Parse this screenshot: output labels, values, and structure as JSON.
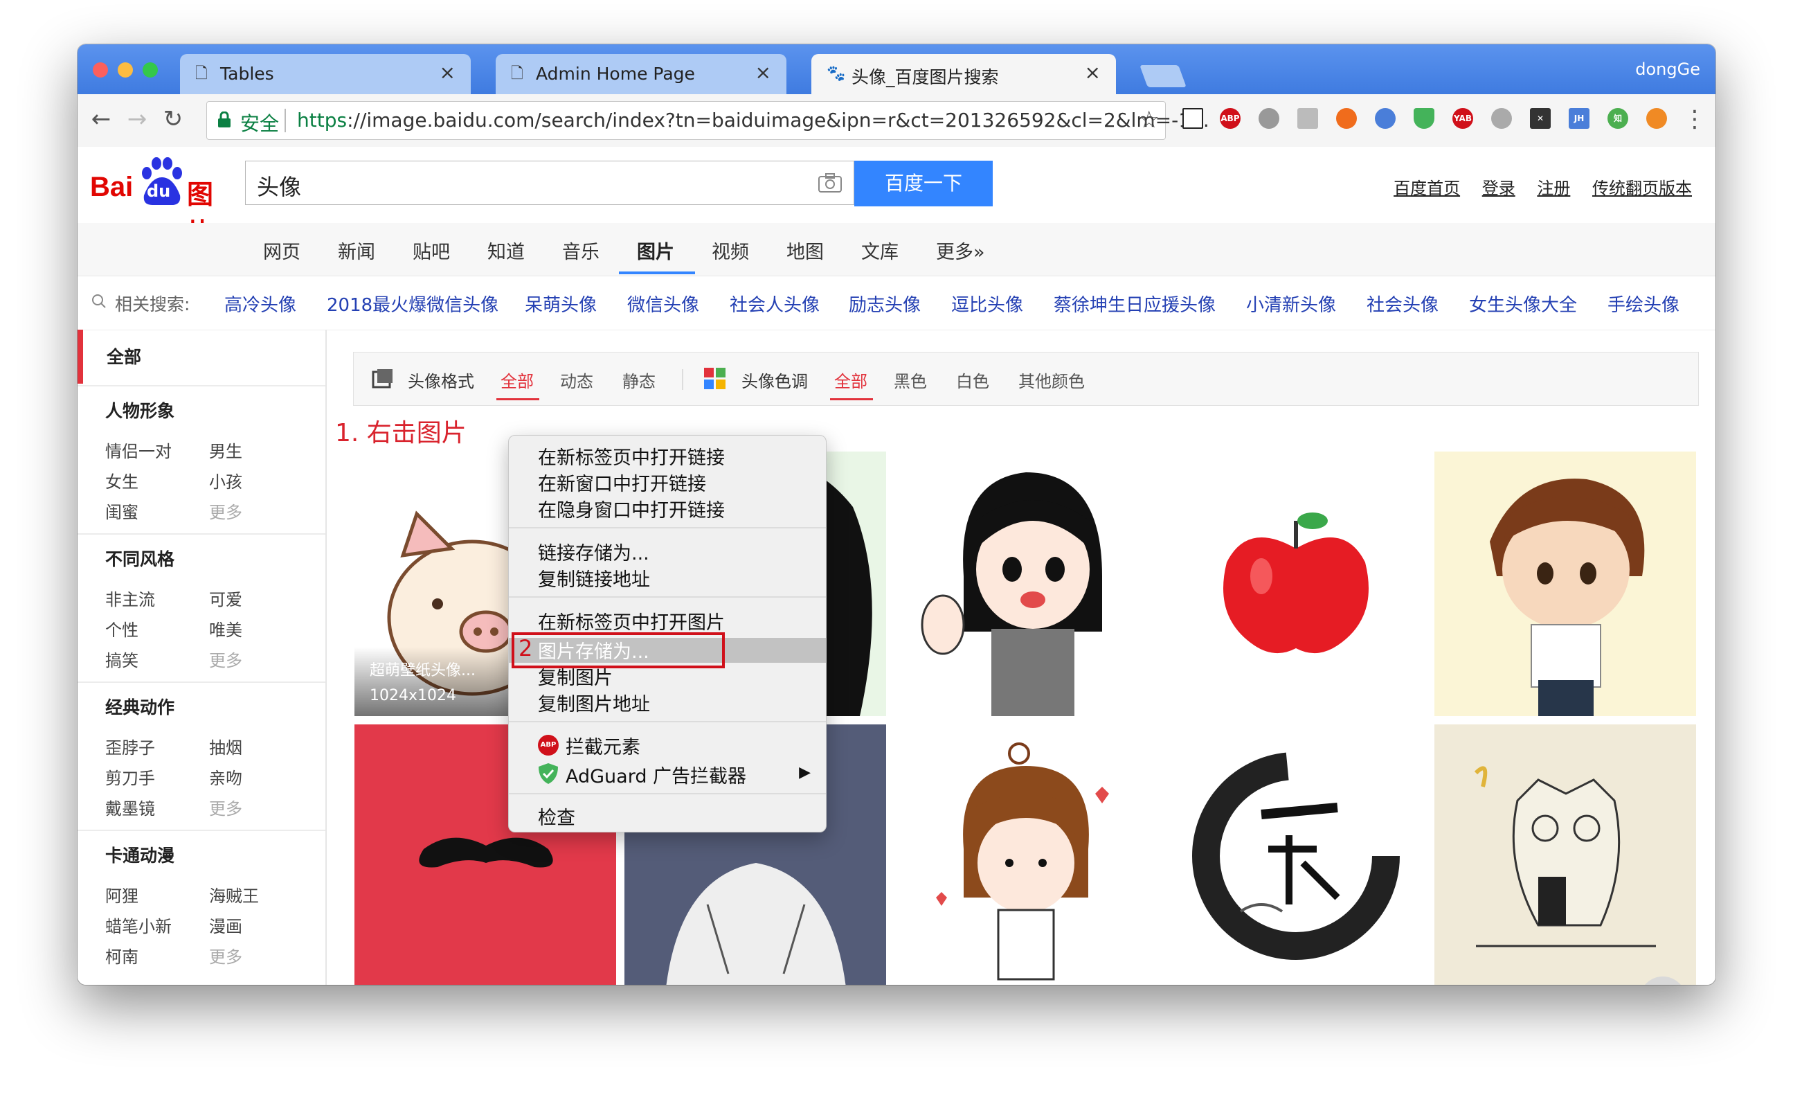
{
  "window": {
    "profile": "dongGe"
  },
  "tabs": [
    {
      "title": "Tables"
    },
    {
      "title": "Admin Home Page"
    },
    {
      "title": "头像_百度图片搜索"
    }
  ],
  "toolbar": {
    "secure_label": "安全",
    "url_scheme": "https",
    "url_rest": "://image.baidu.com/search/index?tn=baiduimage&ipn=r&ct=201326592&cl=2&lm=-1..."
  },
  "extensions": [
    "ABP",
    "YAB",
    "JH",
    "知"
  ],
  "header": {
    "logo_text_bai": "Bai",
    "logo_text_du": "du",
    "logo_text_tupian": "图片",
    "query": "头像",
    "search_button": "百度一下",
    "links": [
      "百度首页",
      "登录",
      "注册",
      "传统翻页版本"
    ]
  },
  "nav": {
    "items": [
      "网页",
      "新闻",
      "贴吧",
      "知道",
      "音乐",
      "图片",
      "视频",
      "地图",
      "文库",
      "更多»"
    ],
    "active": "图片"
  },
  "related": {
    "label": "相关搜索:",
    "links": [
      "高冷头像",
      "2018最火爆微信头像",
      "呆萌头像",
      "微信头像",
      "社会人头像",
      "励志头像",
      "逗比头像",
      "蔡徐坤生日应援头像",
      "小清新头像",
      "社会头像",
      "女生头像大全",
      "手绘头像"
    ]
  },
  "sidebar": {
    "all": "全部",
    "groups": [
      {
        "title": "人物形象",
        "items": [
          "情侣一对",
          "男生",
          "女生",
          "小孩",
          "闺蜜",
          "更多"
        ]
      },
      {
        "title": "不同风格",
        "items": [
          "非主流",
          "可爱",
          "个性",
          "唯美",
          "搞笑",
          "更多"
        ]
      },
      {
        "title": "经典动作",
        "items": [
          "歪脖子",
          "抽烟",
          "剪刀手",
          "亲吻",
          "戴墨镜",
          "更多"
        ]
      },
      {
        "title": "卡通动漫",
        "items": [
          "阿狸",
          "海贼王",
          "蜡笔小新",
          "漫画",
          "柯南",
          "更多"
        ]
      }
    ]
  },
  "filters": {
    "format_label": "头像格式",
    "format_options": [
      "全部",
      "动态",
      "静态"
    ],
    "color_label": "头像色调",
    "color_options": [
      "全部",
      "黑色",
      "白色",
      "其他颜色"
    ]
  },
  "thumb_caption": {
    "title": "超萌壁纸头像...",
    "size": "1024x1024"
  },
  "annotations": {
    "step1": "1. 右击图片",
    "step2": "2"
  },
  "context_menu": {
    "items": [
      "在新标签页中打开链接",
      "在新窗口中打开链接",
      "在隐身窗口中打开链接",
      "链接存储为...",
      "复制链接地址",
      "在新标签页中打开图片",
      "图片存储为...",
      "复制图片",
      "复制图片地址",
      "拦截元素",
      "AdGuard 广告拦截器",
      "检查"
    ],
    "highlighted": "图片存储为..."
  },
  "help_button": "!",
  "colors": {
    "titlebar": "#4a86e8",
    "accent": "#3385ff",
    "red": "#e2323c",
    "link": "#2440b3"
  }
}
